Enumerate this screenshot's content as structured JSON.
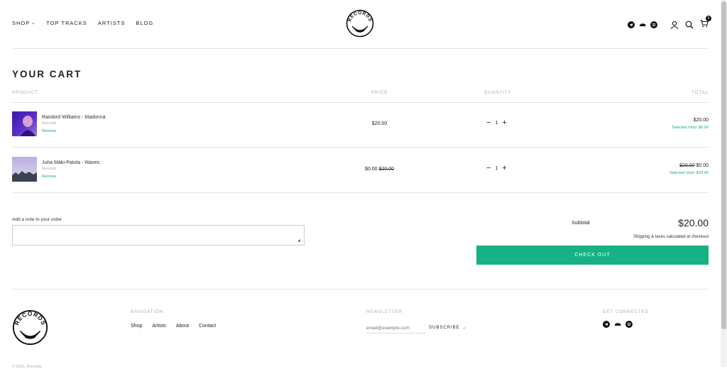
{
  "header": {
    "nav": [
      {
        "label": "SHOP"
      },
      {
        "label": "TOP TRACKS"
      },
      {
        "label": "ARTISTS"
      },
      {
        "label": "BLOG"
      }
    ],
    "logo_text": "RECORDS",
    "cart_count": "0",
    "social_icons": [
      "telegram-icon",
      "soundcloud-icon",
      "spotify-icon"
    ],
    "utility_icons": [
      "account-icon",
      "search-icon",
      "cart-icon"
    ]
  },
  "cart": {
    "title": "YOUR CART",
    "columns": {
      "product": "PRODUCT",
      "price": "PRICE",
      "quantity": "QUANTITY",
      "total": "TOTAL"
    },
    "items": [
      {
        "name": "Rainbird Williams - Madonna",
        "vendor": "Records",
        "remove": "Remove",
        "price": "$20.00",
        "price_original": "",
        "quantity": "1",
        "total": "$20.00",
        "total_original": "",
        "discount": "Selected Vinyl -$0.00"
      },
      {
        "name": "Juha Mäki-Patola - Waves",
        "vendor": "Records",
        "remove": "Remove",
        "price": "$0.00",
        "price_original": "$20.00",
        "quantity": "1",
        "total": "$0.00",
        "total_original": "$20.00",
        "discount": "Selected Vinyl -$20.00"
      }
    ],
    "note_label": "Add a note to your order",
    "subtotal_label": "Subtotal",
    "subtotal_value": "$20.00",
    "shipping_note": "Shipping & taxes calculated at checkout",
    "checkout_label": "CHECK OUT"
  },
  "footer": {
    "navigation_heading": "NAVIGATION",
    "links": [
      "Shop",
      "Artists",
      "About",
      "Contact"
    ],
    "newsletter_heading": "NEWSLETTER",
    "email_placeholder": "email@example.com",
    "subscribe_label": "SUBSCRIBE →",
    "connected_heading": "GET CONNECTED",
    "copyright": "© 2021, Records"
  },
  "colors": {
    "accent": "#17b283",
    "discount": "#17a87e"
  }
}
